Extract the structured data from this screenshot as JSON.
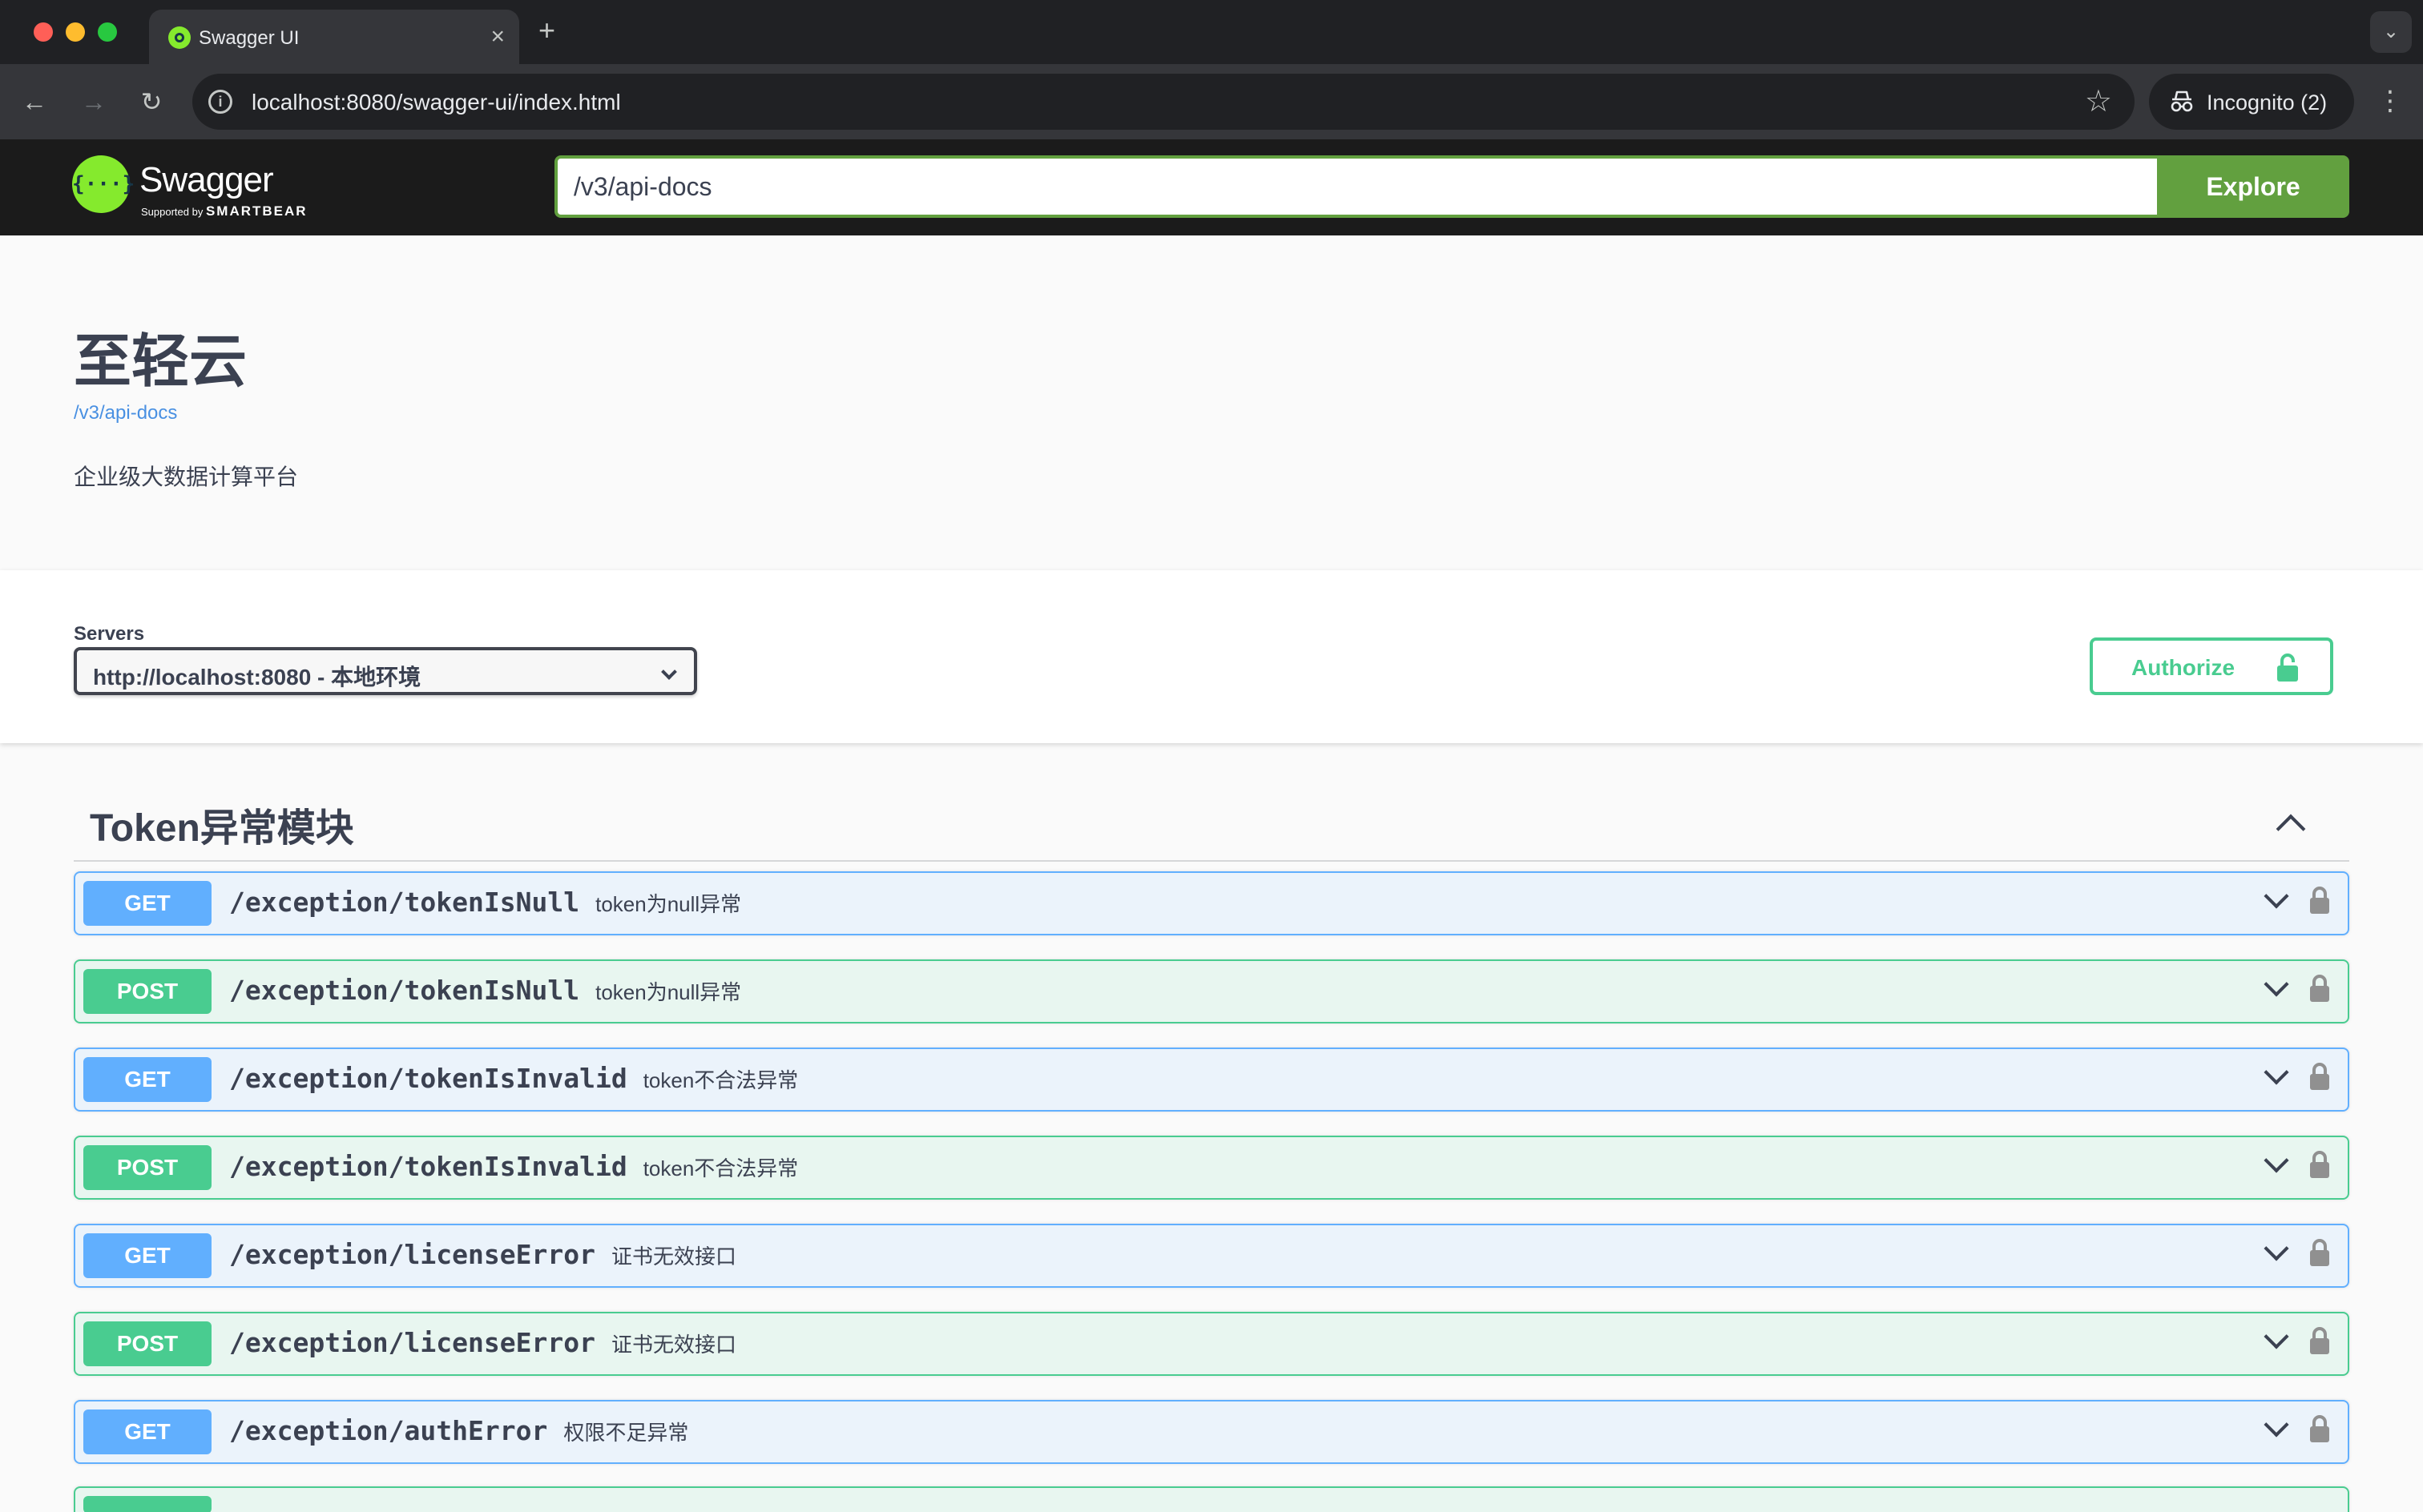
{
  "browser": {
    "tab_title": "Swagger UI",
    "tab_close": "×",
    "new_tab": "+",
    "tab_search": "⌄",
    "url": "localhost:8080/swagger-ui/index.html",
    "incognito_label": "Incognito (2)",
    "nav": {
      "back": "←",
      "forward": "→",
      "reload": "↻",
      "info": "i",
      "star": "☆",
      "menu": "⋮"
    }
  },
  "topbar": {
    "logo_icon": "{···}",
    "logo_text": "Swagger",
    "logo_sub_prefix": "Supported by ",
    "logo_sub_brand": "SMARTBEAR",
    "spec_url": "/v3/api-docs",
    "explore_label": "Explore"
  },
  "info": {
    "title": "至轻云",
    "spec_link": "/v3/api-docs",
    "description": "企业级大数据计算平台"
  },
  "scheme": {
    "servers_label": "Servers",
    "server_selected": "http://localhost:8080 - 本地环境",
    "authorize_label": "Authorize"
  },
  "tag": {
    "name": "Token异常模块"
  },
  "operations": [
    {
      "method": "GET",
      "path": "/exception/tokenIsNull",
      "summary": "token为null异常"
    },
    {
      "method": "POST",
      "path": "/exception/tokenIsNull",
      "summary": "token为null异常"
    },
    {
      "method": "GET",
      "path": "/exception/tokenIsInvalid",
      "summary": "token不合法异常"
    },
    {
      "method": "POST",
      "path": "/exception/tokenIsInvalid",
      "summary": "token不合法异常"
    },
    {
      "method": "GET",
      "path": "/exception/licenseError",
      "summary": "证书无效接口"
    },
    {
      "method": "POST",
      "path": "/exception/licenseError",
      "summary": "证书无效接口"
    },
    {
      "method": "GET",
      "path": "/exception/authError",
      "summary": "权限不足异常"
    }
  ],
  "colors": {
    "get": "#61affe",
    "post": "#49cc90",
    "explore": "#62a03f",
    "logo": "#85ea2d"
  },
  "icons": {
    "lock": "lock-icon",
    "chevron": "chevron-down-icon",
    "collapse": "chevron-up-icon"
  }
}
